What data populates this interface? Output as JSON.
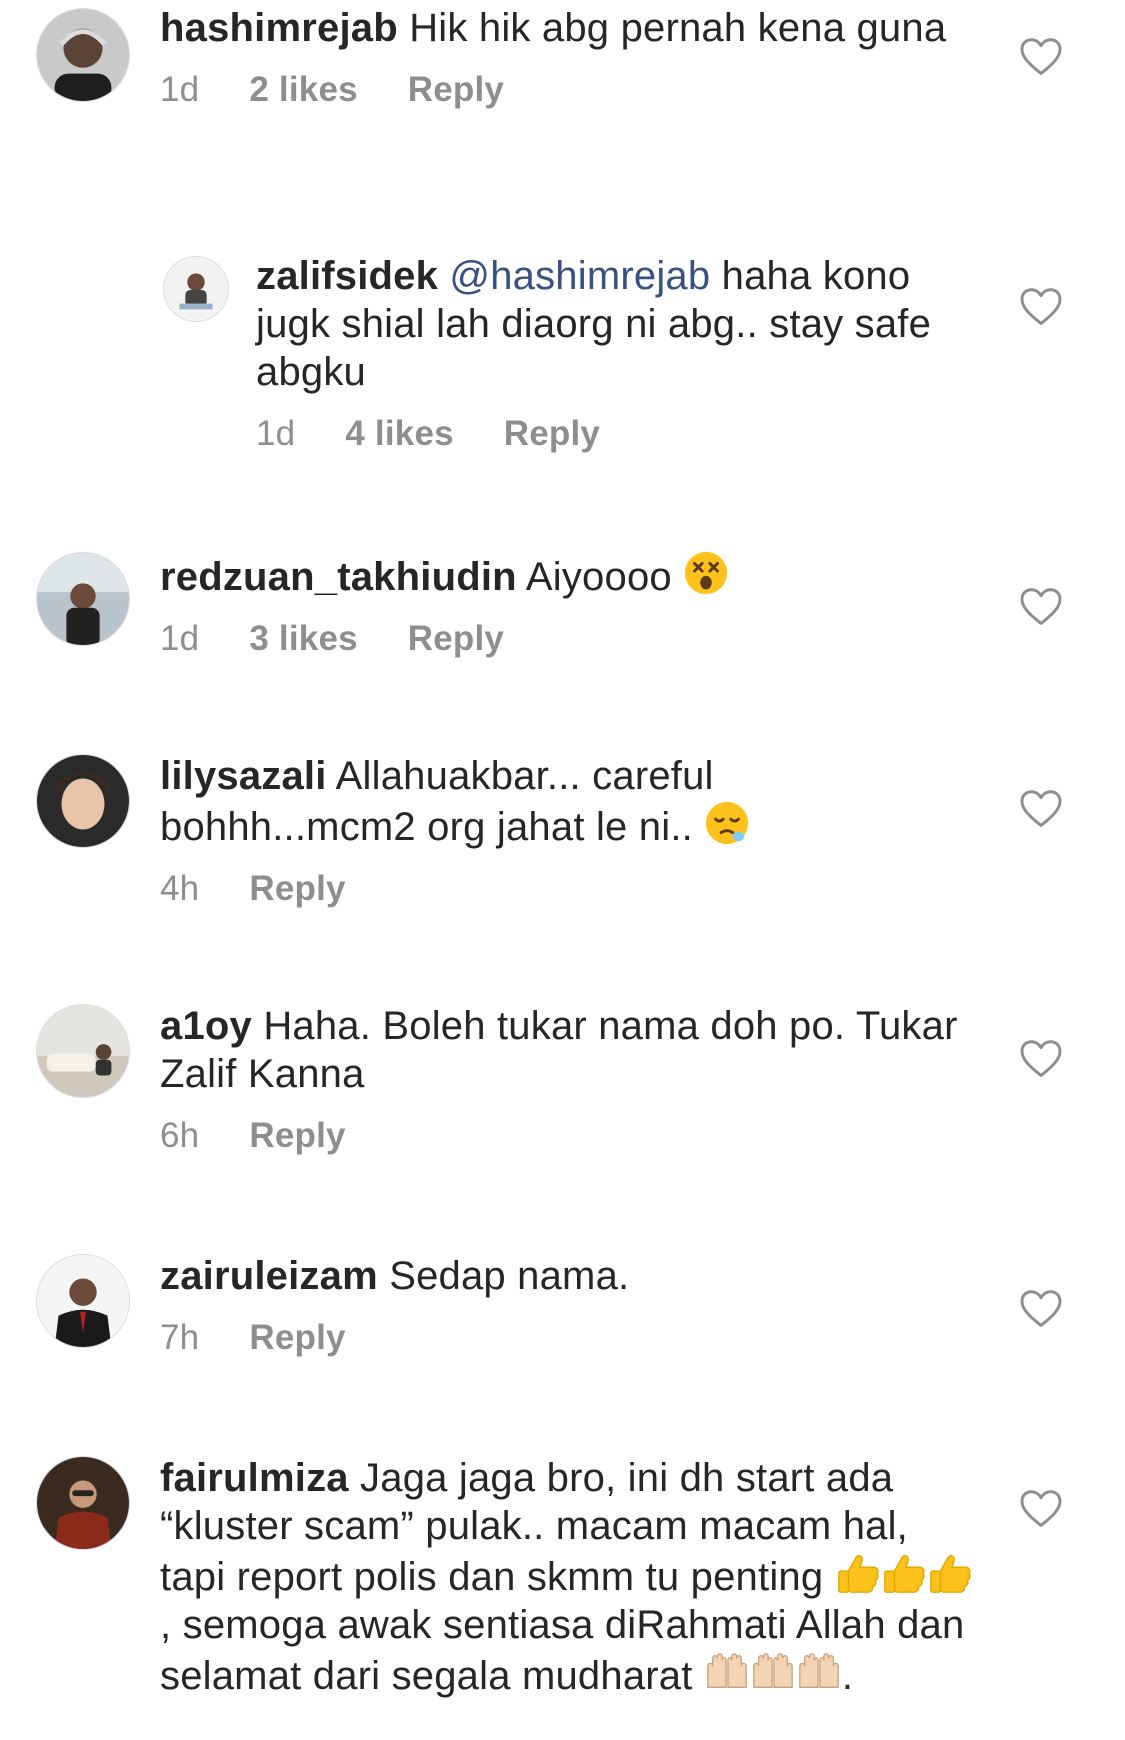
{
  "comments": [
    {
      "username": "hashimrejab",
      "text": "Hik hik abg pernah kena guna",
      "time": "1d",
      "likes": "2 likes",
      "reply": "Reply",
      "avatar_icon": "avatar-photo"
    },
    {
      "username": "zalifsidek",
      "mention": "@hashimrejab",
      "text": "haha kono jugk shial lah diaorg ni abg.. stay safe abgku",
      "time": "1d",
      "likes": "4 likes",
      "reply": "Reply",
      "avatar_icon": "avatar-photo"
    },
    {
      "username": "redzuan_takhiudin",
      "text": "Aiyoooo",
      "emoji": "dizzy-face-emoji",
      "time": "1d",
      "likes": "3 likes",
      "reply": "Reply",
      "avatar_icon": "avatar-photo"
    },
    {
      "username": "lilysazali",
      "text": "Allahuakbar... careful bohhh...mcm2 org jahat le ni..",
      "emoji": "sleepy-face-emoji",
      "time": "4h",
      "reply": "Reply",
      "avatar_icon": "avatar-photo"
    },
    {
      "username": "a1oy",
      "text": "Haha. Boleh tukar nama doh po. Tukar Zalif Kanna",
      "time": "6h",
      "reply": "Reply",
      "avatar_icon": "avatar-photo"
    },
    {
      "username": "zairuleizam",
      "text": "Sedap nama.",
      "time": "7h",
      "reply": "Reply",
      "avatar_icon": "avatar-photo"
    },
    {
      "username": "fairulmiza",
      "text_part1": "Jaga jaga bro, ini dh start ada “kluster scam” pulak.. macam macam hal, tapi report polis dan skmm tu penting",
      "text_part2": ", semoga awak sentiasa diRahmati Allah dan selamat dari segala mudharat",
      "text_part3": ".",
      "emoji_1": "thumbs-up-emoji",
      "emoji_2": "raised-hands-emoji",
      "avatar_icon": "avatar-photo"
    }
  ],
  "colors": {
    "text": "#262626",
    "meta": "#8e8e8e",
    "mention": "#385185",
    "heart_outline": "#8e8e8e"
  }
}
